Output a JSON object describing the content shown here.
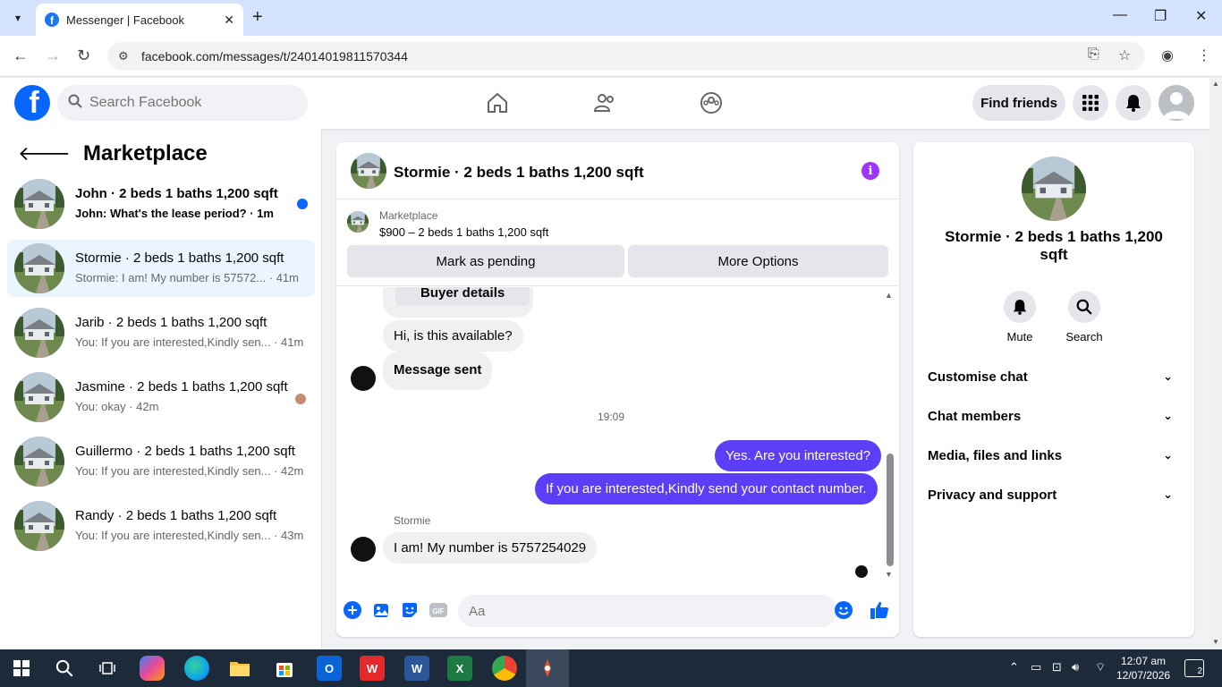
{
  "browser": {
    "tab_title": "Messenger | Facebook",
    "url": "facebook.com/messages/t/24014019811570344"
  },
  "fb": {
    "search_placeholder": "Search Facebook",
    "find_friends": "Find friends"
  },
  "sidebar": {
    "title": "Marketplace",
    "chats": [
      {
        "name": "John · 2 beds 1 baths 1,200 sqft",
        "snippet": "John: What's the lease period? · 1m",
        "unread": true
      },
      {
        "name": "Stormie · 2 beds 1 baths 1,200 sqft",
        "snippet": "Stormie: I am! My number is 57572... · 41m",
        "active": true
      },
      {
        "name": "Jarib · 2 beds 1 baths 1,200 sqft",
        "snippet": "You: If you are interested,Kindly sen... · 41m"
      },
      {
        "name": "Jasmine · 2 beds 1 baths 1,200 sqft",
        "snippet": "You: okay · 42m"
      },
      {
        "name": "Guillermo · 2 beds 1 baths 1,200 sqft",
        "snippet": "You: If you are interested,Kindly sen... · 42m"
      },
      {
        "name": "Randy · 2 beds 1 baths 1,200 sqft",
        "snippet": "You: If you are interested,Kindly sen... · 43m"
      }
    ]
  },
  "conversation": {
    "title": "Stormie · 2 beds 1 baths 1,200 sqft",
    "marketplace_label": "Marketplace",
    "listing": "$900 – 2 beds 1 baths 1,200 sqft",
    "mark_pending": "Mark as pending",
    "more_options": "More Options",
    "buyer_details": "Buyer details",
    "msg_available": "Hi, is this available?",
    "msg_sent": "Message sent",
    "timestamp": "19:09",
    "msg_out_1": "Yes. Are you interested?",
    "msg_out_2": "If you are interested,Kindly send your contact number.",
    "sender_name": "Stormie",
    "msg_in_number": "I am! My number is 5757254029",
    "composer_placeholder": "Aa",
    "gif_label": "GIF"
  },
  "details": {
    "name": "Stormie · 2 beds 1 baths 1,200 sqft",
    "mute": "Mute",
    "search": "Search",
    "sections": [
      "Customise chat",
      "Chat members",
      "Media, files and links",
      "Privacy and support"
    ]
  },
  "taskbar": {
    "time": "12:07 am",
    "date": "12/07/2026",
    "notifications": "2"
  },
  "colors": {
    "fb_blue": "#0866ff",
    "outgoing_bubble": "#5b3ef5",
    "info_purple": "#a033ff"
  }
}
